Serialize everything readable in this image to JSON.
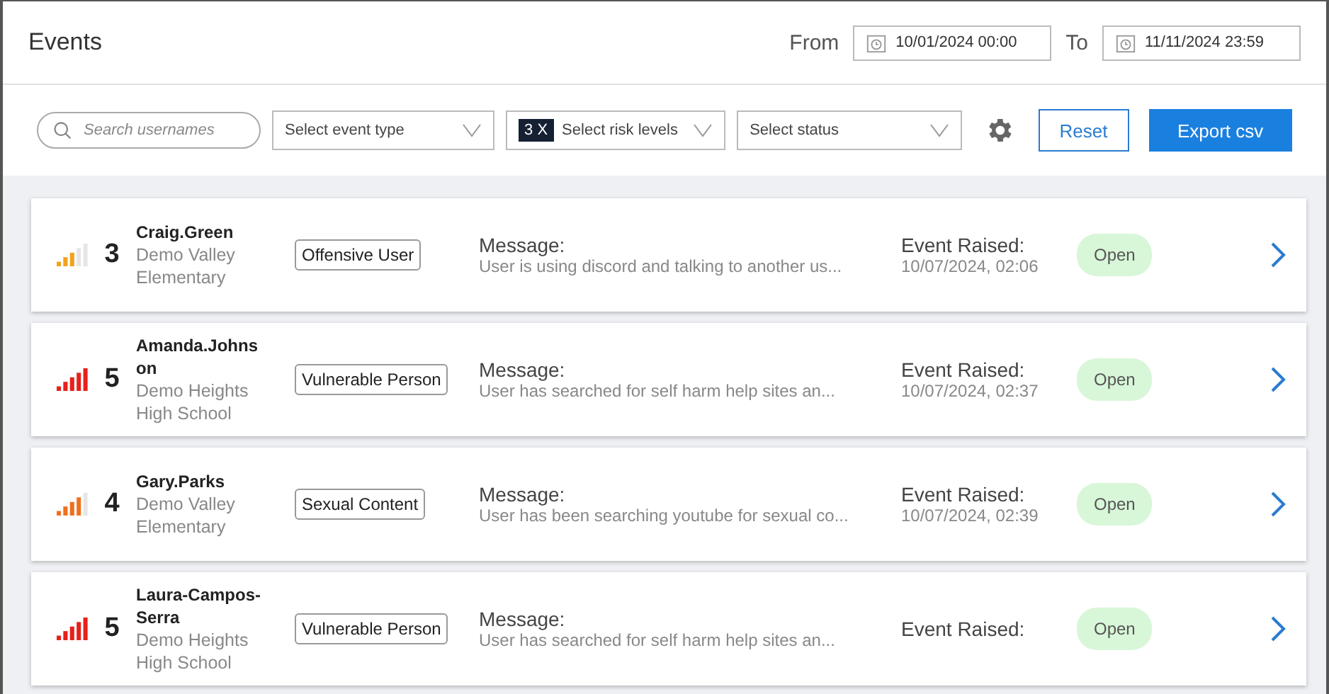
{
  "header": {
    "title": "Events",
    "from_label": "From",
    "from_value": "10/01/2024 00:00",
    "to_label": "To",
    "to_value": "11/11/2024 23:59"
  },
  "filters": {
    "search_placeholder": "Search usernames",
    "event_type": "Select event type",
    "risk_badge": "3 X",
    "risk_levels": "Select risk levels",
    "status": "Select status",
    "reset": "Reset",
    "export": "Export csv"
  },
  "events": [
    {
      "level": 0.6,
      "color": "#f2a31c",
      "risk": "3",
      "user": "Craig.Green",
      "school": "Demo Valley Elementary",
      "tag": "Offensive User",
      "message_label": "Message:",
      "message": "User is using discord and talking to another us...",
      "raised_label": "Event Raised:",
      "raised": "10/07/2024, 02:06",
      "status": "Open"
    },
    {
      "level": 1,
      "color": "#e8201a",
      "risk": "5",
      "user": "Amanda.Johns on",
      "school": "Demo Heights High School",
      "tag": "Vulnerable Person",
      "message_label": "Message:",
      "message": "User has searched for self harm help sites an...",
      "raised_label": "Event Raised:",
      "raised": "10/07/2024, 02:37",
      "status": "Open"
    },
    {
      "level": 0.8,
      "color": "#f0701c",
      "risk": "4",
      "user": "Gary.Parks",
      "school": "Demo Valley Elementary",
      "tag": "Sexual Content",
      "message_label": "Message:",
      "message": "User has been searching youtube for sexual co...",
      "raised_label": "Event Raised:",
      "raised": "10/07/2024, 02:39",
      "status": "Open"
    },
    {
      "level": 1,
      "color": "#e8201a",
      "risk": "5",
      "user": "Laura-Campos-Serra",
      "school": "Demo Heights High School",
      "tag": "Vulnerable Person",
      "message_label": "Message:",
      "message": "User has searched for self harm help sites an...",
      "raised_label": "Event Raised:",
      "status": "Open"
    }
  ]
}
